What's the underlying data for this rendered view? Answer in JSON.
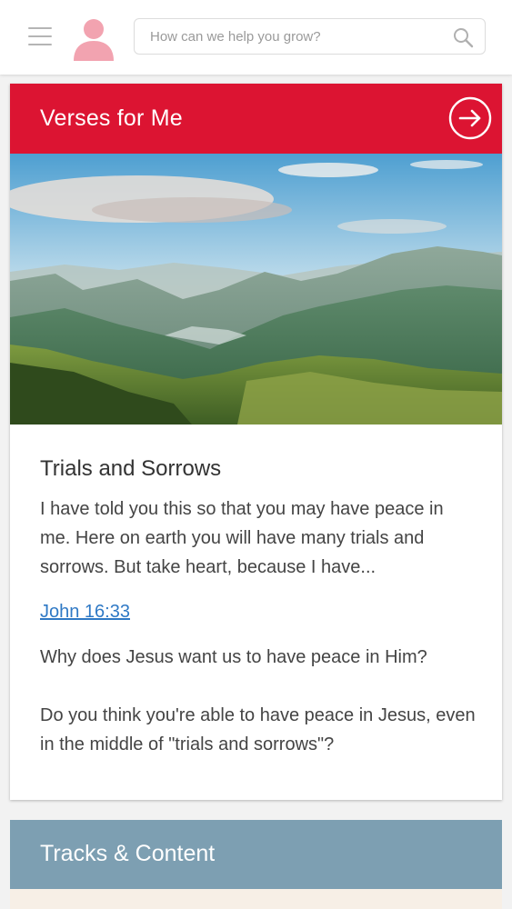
{
  "header": {
    "search_placeholder": "How can we help you grow?",
    "icons": {
      "menu": "hamburger-menu-icon",
      "avatar": "user-avatar-icon",
      "search": "search-icon"
    }
  },
  "verses_card": {
    "title": "Verses for Me",
    "accent_color": "#dc1432",
    "verse_title": "Trials and Sorrows",
    "verse_text": "I have told you this so that you may have peace in me. Here on earth you will have many trials and sorrows. But take heart, because I have...",
    "reference": "John 16:33",
    "question_1": "Why does Jesus want us to have peace in Him?",
    "question_2": "Do you think you're able to have peace in Jesus, even in the middle of \"trials and sorrows\"?"
  },
  "tracks_card": {
    "title": "Tracks & Content",
    "accent_color": "#7d9fb2"
  }
}
